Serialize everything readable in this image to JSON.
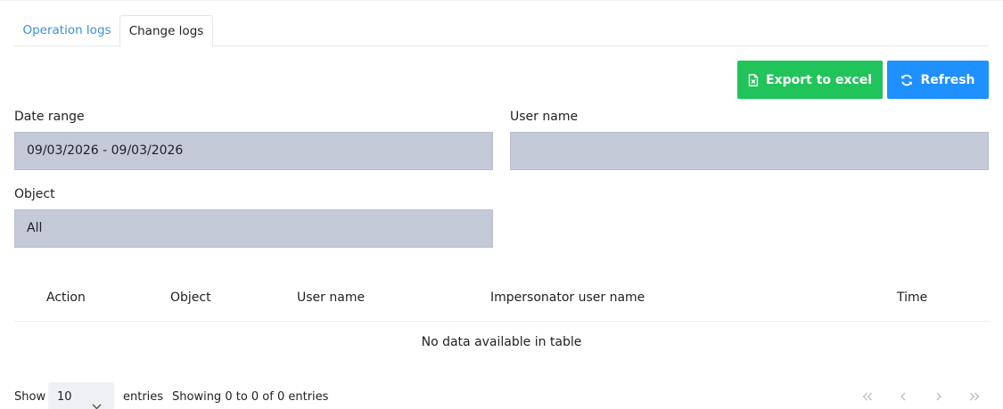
{
  "tabs": [
    {
      "label": "Operation logs",
      "active": false
    },
    {
      "label": "Change logs",
      "active": true
    }
  ],
  "toolbar": {
    "export_label": "Export to excel",
    "refresh_label": "Refresh",
    "export_color": "#21c45a",
    "refresh_color": "#1e90ff"
  },
  "filters": {
    "date_range_label": "Date range",
    "date_range_value": "09/03/2026 - 09/03/2026",
    "user_name_label": "User name",
    "user_name_value": "",
    "object_label": "Object",
    "object_value": "All"
  },
  "table": {
    "columns": [
      "Action",
      "Object",
      "User name",
      "Impersonator user name",
      "Time"
    ],
    "empty_text": "No data available in table"
  },
  "footer": {
    "show_label": "Show",
    "page_length": "10",
    "entries_label": "entries",
    "info": "Showing 0 to 0 of 0 entries"
  },
  "pagination": {
    "icons": [
      "first-page-icon",
      "previous-page-icon",
      "next-page-icon",
      "last-page-icon"
    ]
  }
}
